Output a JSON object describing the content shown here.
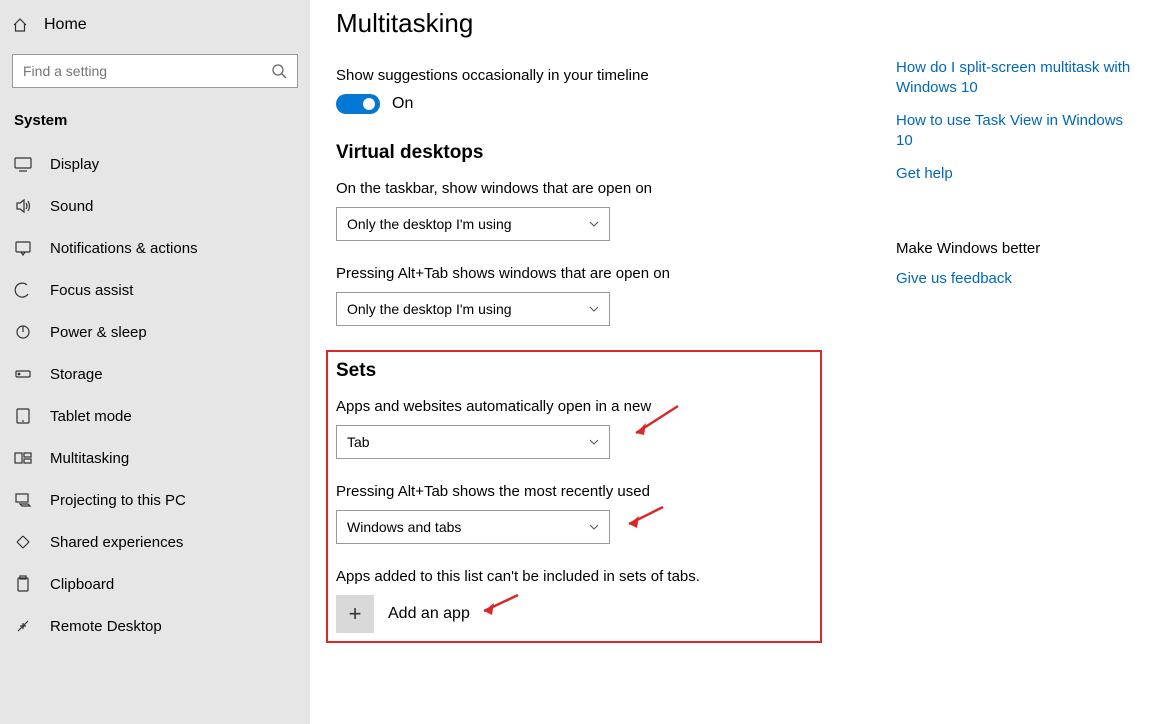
{
  "sidebar": {
    "home": "Home",
    "search_placeholder": "Find a setting",
    "category": "System",
    "items": [
      {
        "label": "Display"
      },
      {
        "label": "Sound"
      },
      {
        "label": "Notifications & actions"
      },
      {
        "label": "Focus assist"
      },
      {
        "label": "Power & sleep"
      },
      {
        "label": "Storage"
      },
      {
        "label": "Tablet mode"
      },
      {
        "label": "Multitasking"
      },
      {
        "label": "Projecting to this PC"
      },
      {
        "label": "Shared experiences"
      },
      {
        "label": "Clipboard"
      },
      {
        "label": "Remote Desktop"
      }
    ]
  },
  "main": {
    "title": "Multitasking",
    "timeline_label": "Show suggestions occasionally in your timeline",
    "toggle_state": "On",
    "vd_heading": "Virtual desktops",
    "vd_taskbar_label": "On the taskbar, show windows that are open on",
    "vd_taskbar_value": "Only the desktop I'm using",
    "vd_alttab_label": "Pressing Alt+Tab shows windows that are open on",
    "vd_alttab_value": "Only the desktop I'm using",
    "sets_heading": "Sets",
    "sets_open_label": "Apps and websites automatically open in a new",
    "sets_open_value": "Tab",
    "sets_alttab_label": "Pressing Alt+Tab shows the most recently used",
    "sets_alttab_value": "Windows and tabs",
    "sets_exclude_label": "Apps added to this list can't be included in sets of tabs.",
    "add_app_label": "Add an app"
  },
  "rail": {
    "links": [
      "How do I split-screen multitask with Windows 10",
      "How to use Task View in Windows 10",
      "Get help"
    ],
    "feedback_heading": "Make Windows better",
    "feedback_link": "Give us feedback"
  }
}
